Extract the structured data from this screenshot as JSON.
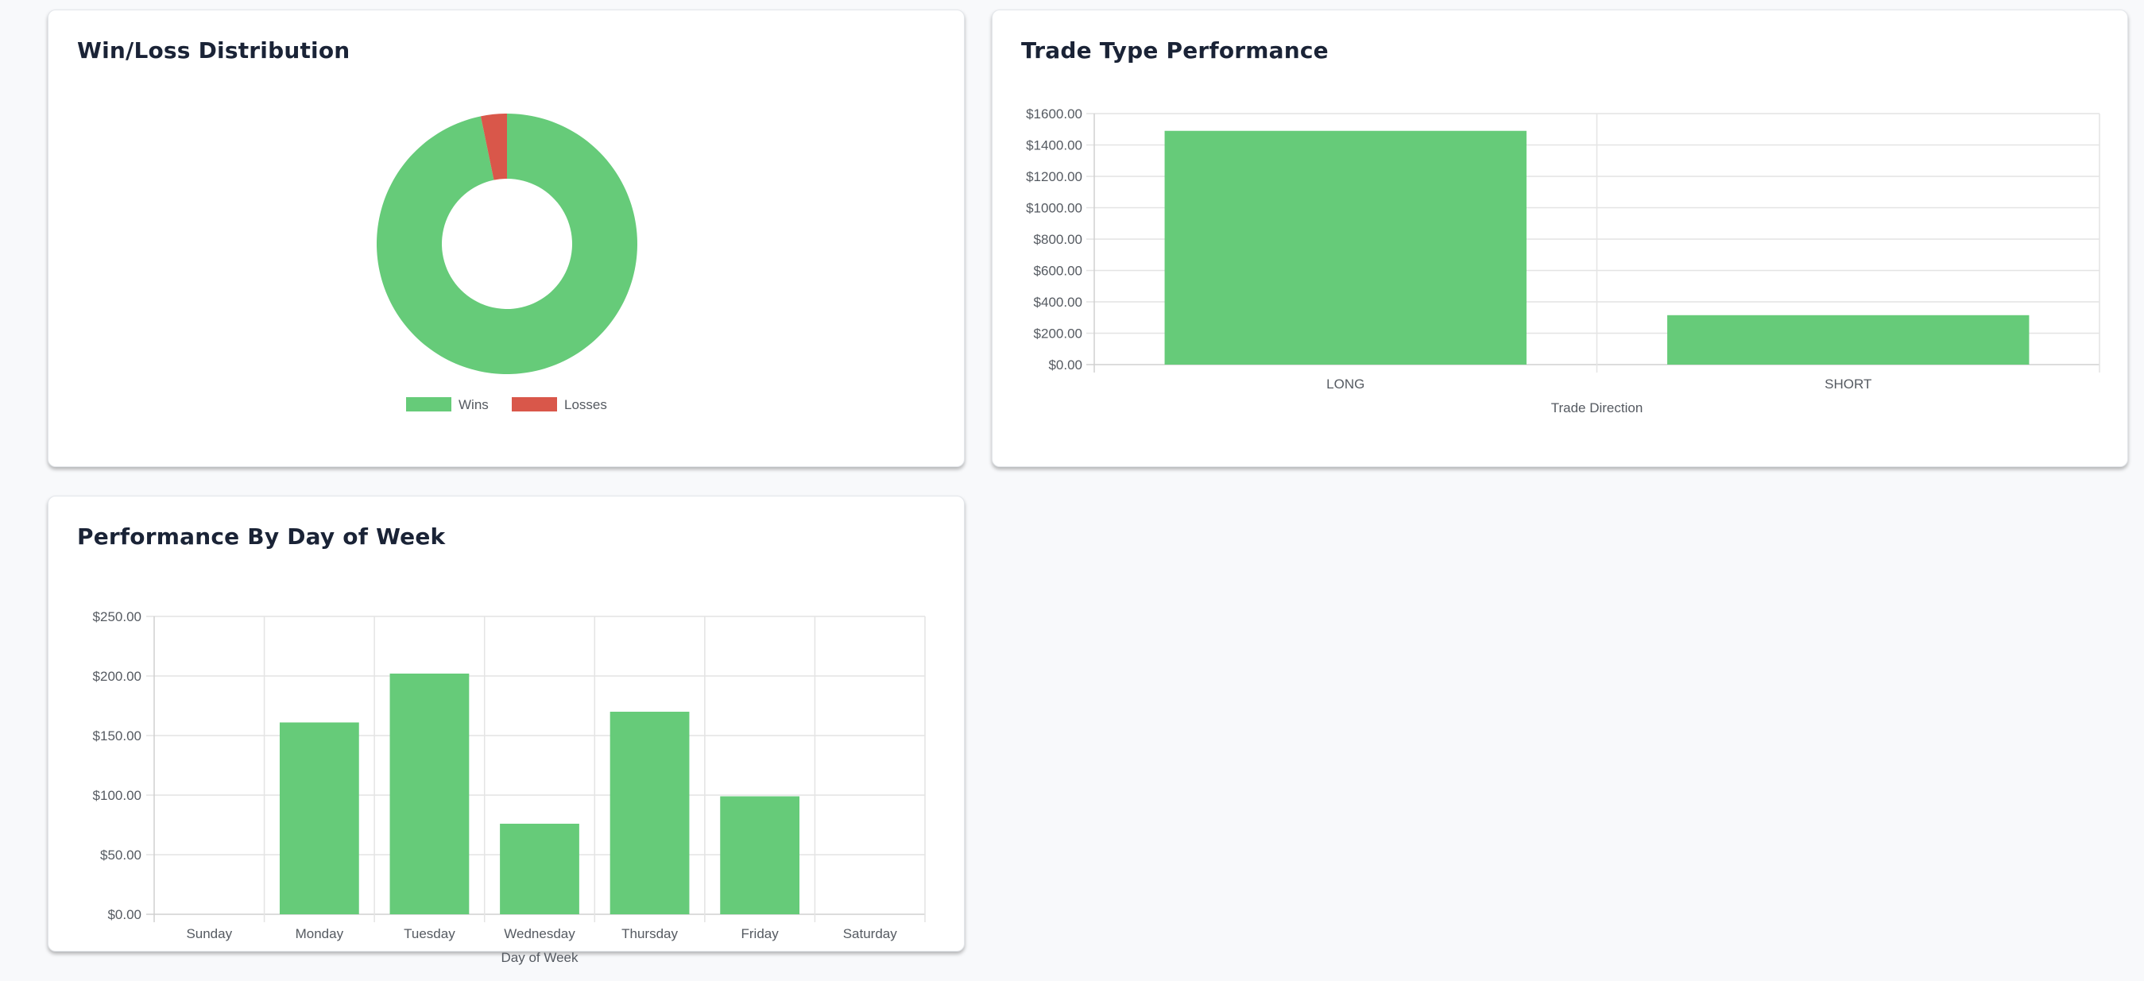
{
  "colors": {
    "win": "#66cb79",
    "loss": "#d9574a",
    "bar": "#66cb79"
  },
  "cards": {
    "winloss": {
      "title": "Win/Loss Distribution"
    },
    "tradetype": {
      "title": "Trade Type Performance"
    },
    "dayofweek": {
      "title": "Performance By Day of Week"
    }
  },
  "chart_data": [
    {
      "type": "pie",
      "variant": "doughnut",
      "title": "Win/Loss Distribution",
      "labels": [
        "Wins",
        "Losses"
      ],
      "values": [
        30,
        1
      ],
      "legend": "bottom"
    },
    {
      "type": "bar",
      "title": "Trade Type Performance",
      "categories": [
        "LONG",
        "SHORT"
      ],
      "values": [
        1490,
        315
      ],
      "xlabel": "Trade Direction",
      "ylabel": "",
      "ylim": [
        0,
        1600
      ],
      "yticks": [
        "$0.00",
        "$200.00",
        "$400.00",
        "$600.00",
        "$800.00",
        "$1000.00",
        "$1200.00",
        "$1400.00",
        "$1600.00"
      ],
      "grid": true
    },
    {
      "type": "bar",
      "title": "Performance By Day of Week",
      "categories": [
        "Sunday",
        "Monday",
        "Tuesday",
        "Wednesday",
        "Thursday",
        "Friday",
        "Saturday"
      ],
      "values": [
        0,
        161,
        202,
        76,
        170,
        99,
        0
      ],
      "xlabel": "Day of Week",
      "ylabel": "",
      "ylim": [
        0,
        250
      ],
      "yticks": [
        "$0.00",
        "$50.00",
        "$100.00",
        "$150.00",
        "$200.00",
        "$250.00"
      ],
      "grid": true
    }
  ]
}
